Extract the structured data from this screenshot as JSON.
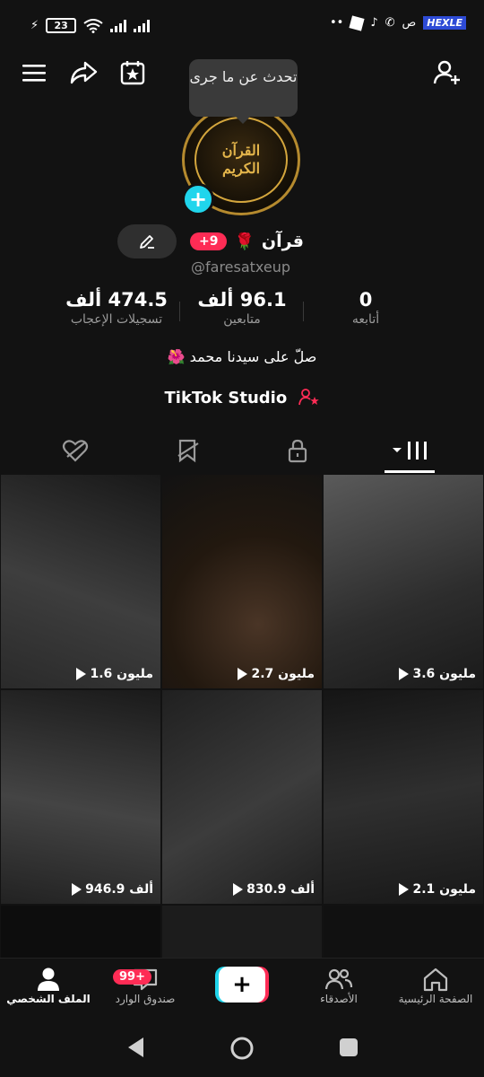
{
  "status_bar": {
    "battery": "23",
    "tag": "HEXLE",
    "notif_text": "ص"
  },
  "tooltip": {
    "text": "تحدث عن ما جرى"
  },
  "profile": {
    "avatar_text": "القرآن الكريم",
    "name": "قرآن",
    "name_emoji": "🌹",
    "messages_badge": "+9",
    "username": "@faresatxeup",
    "bio": "صلّ على سيدنا محمد 🌺",
    "studio_label": "TikTok Studio"
  },
  "stats": {
    "likes": {
      "value": "474.5 ألف",
      "label": "تسجيلات الإعجاب"
    },
    "followers": {
      "value": "96.1 ألف",
      "label": "متابعين"
    },
    "following": {
      "value": "0",
      "label": "أتابعه"
    }
  },
  "videos": [
    {
      "views": "3.6 مليون",
      "tone": "#3b3b3b"
    },
    {
      "views": "2.7 مليون",
      "tone": "#2a221d"
    },
    {
      "views": "1.6 مليون",
      "tone": "#2c2c2c"
    },
    {
      "views": "2.1 مليون",
      "tone": "#1c1c1c"
    },
    {
      "views": "830.9 ألف",
      "tone": "#262626"
    },
    {
      "views": "946.9 ألف",
      "tone": "#2a2a2a"
    }
  ],
  "bottom_nav": {
    "home": "الصفحة الرئيسية",
    "friends": "الأصدقاء",
    "inbox": "صندوق الوارد",
    "inbox_badge": "99+",
    "profile": "الملف الشخصي"
  },
  "colors": {
    "accent": "#fe2c55",
    "cyan": "#20d5ec",
    "background": "#121212"
  }
}
